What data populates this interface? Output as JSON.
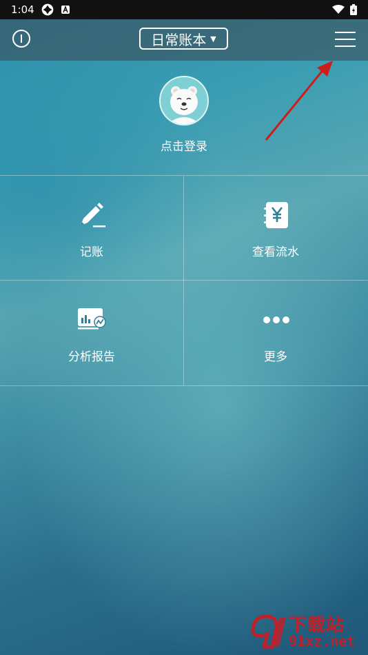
{
  "status_bar": {
    "time": "1:04"
  },
  "header": {
    "account_book": "日常账本"
  },
  "profile": {
    "login_text": "点击登录"
  },
  "menu_grid": [
    {
      "label": "记账",
      "icon": "pen-icon"
    },
    {
      "label": "查看流水",
      "icon": "yen-notebook-icon"
    },
    {
      "label": "分析报告",
      "icon": "report-chart-icon"
    },
    {
      "label": "更多",
      "icon": "more-dots-icon"
    }
  ],
  "watermark": {
    "title": "下载站",
    "site": "91xz.net"
  },
  "colors": {
    "arrow": "#cc1c1c",
    "watermark": "#c0202a"
  }
}
